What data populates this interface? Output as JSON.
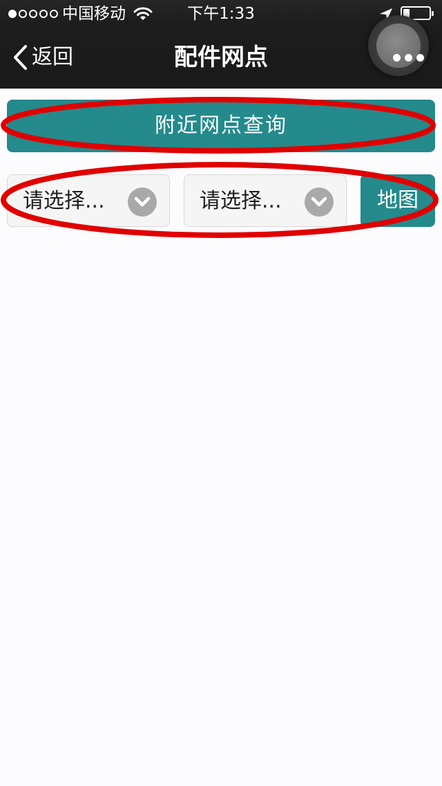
{
  "status_bar": {
    "carrier": "中国移动",
    "time": "下午1:33",
    "signal_bars_filled": 1,
    "signal_bars_total": 5,
    "battery_level": 0.25
  },
  "nav": {
    "back_label": "返回",
    "title": "配件网点"
  },
  "content": {
    "nearby_query_label": "附近网点查询",
    "select_1_label": "请选择...",
    "select_2_label": "请选择...",
    "map_label": "地图"
  },
  "colors": {
    "accent": "#248a8c",
    "topbar": "#1c1c1c",
    "annotation": "#e00000",
    "background": "#fcfbfd"
  }
}
